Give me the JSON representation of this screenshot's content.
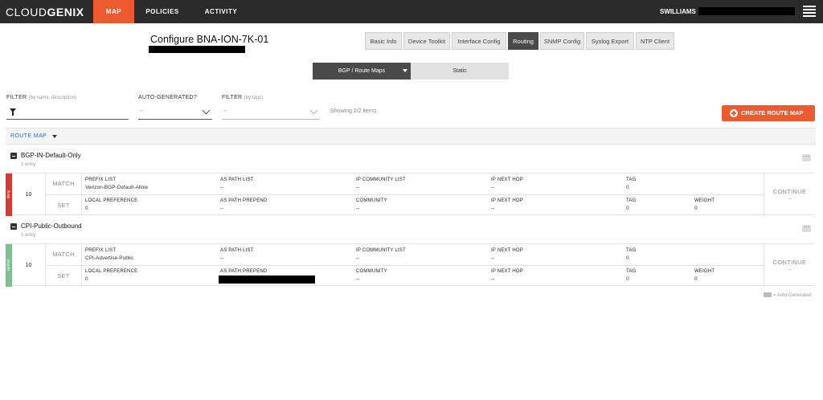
{
  "nav": {
    "logo_light": "CLOUD",
    "logo_bold": "GENIX",
    "tabs": [
      "MAP",
      "POLICIES",
      "ACTIVITY"
    ],
    "user": "SWILLIAMS"
  },
  "page": {
    "title": "Configure BNA-ION-7K-01",
    "config_tabs": [
      "Basic Info",
      "Device Toolkit",
      "Interface Config",
      "Routing",
      "SNMP Config",
      "Syslog Export",
      "NTP Client"
    ],
    "active_tab": "Routing"
  },
  "segments": {
    "active": "BGP / Route Maps",
    "inactive": "Static"
  },
  "filters": {
    "filter_label": "FILTER",
    "filter_hint": "(by name, description)",
    "autogen_label": "AUTO-GENERATED?",
    "autogen_value": "--",
    "tags_label": "FILTER",
    "tags_hint": "(by tags)",
    "tags_value": "--",
    "showing": "Showing 2/2 items",
    "create_button": "CREATE ROUTE MAP"
  },
  "header": {
    "label": "ROUTE MAP"
  },
  "route_maps": [
    {
      "name": "BGP-IN-Default-Only",
      "entries_text": "1 entry",
      "action": "deny",
      "action_color": "#d33a36",
      "seq": "10",
      "match_label": "MATCH",
      "set_label": "SET",
      "match": [
        {
          "h": "PREFIX LIST",
          "v": "Verizon-BGP-Default-Allow"
        },
        {
          "h": "AS PATH LIST",
          "v": "--"
        },
        {
          "h": "IP COMMUNITY LIST",
          "v": "--"
        },
        {
          "h": "IP NEXT HOP",
          "v": "--"
        },
        {
          "h": "TAG",
          "v": "0"
        }
      ],
      "set": [
        {
          "h": "LOCAL PREFERENCE",
          "v": "0"
        },
        {
          "h": "AS PATH PREPEND",
          "v": "--"
        },
        {
          "h": "COMMUNITY",
          "v": "--"
        },
        {
          "h": "IP NEXT HOP",
          "v": "--"
        },
        {
          "h": "TAG",
          "v": "0"
        },
        {
          "h": "WEIGHT",
          "v": "0"
        }
      ],
      "continue_label": "CONTINUE",
      "continue_value": "--"
    },
    {
      "name": "CPI-Public-Outbound",
      "entries_text": "1 entry",
      "action": "permit",
      "action_color": "#7fbf94",
      "seq": "10",
      "match_label": "MATCH",
      "set_label": "SET",
      "match": [
        {
          "h": "PREFIX LIST",
          "v": "CPI-Advertise-Public"
        },
        {
          "h": "AS PATH LIST",
          "v": "--"
        },
        {
          "h": "IP COMMUNITY LIST",
          "v": "--"
        },
        {
          "h": "IP NEXT HOP",
          "v": "--"
        },
        {
          "h": "TAG",
          "v": "0"
        }
      ],
      "set": [
        {
          "h": "LOCAL PREFERENCE",
          "v": "0"
        },
        {
          "h": "AS PATH PREPEND",
          "v": ""
        },
        {
          "h": "COMMUNITY",
          "v": "--"
        },
        {
          "h": "IP NEXT HOP",
          "v": "--"
        },
        {
          "h": "TAG",
          "v": "0"
        },
        {
          "h": "WEIGHT",
          "v": "0"
        }
      ],
      "continue_label": "CONTINUE",
      "continue_value": "--"
    }
  ],
  "legend": "= Auto-Generated"
}
